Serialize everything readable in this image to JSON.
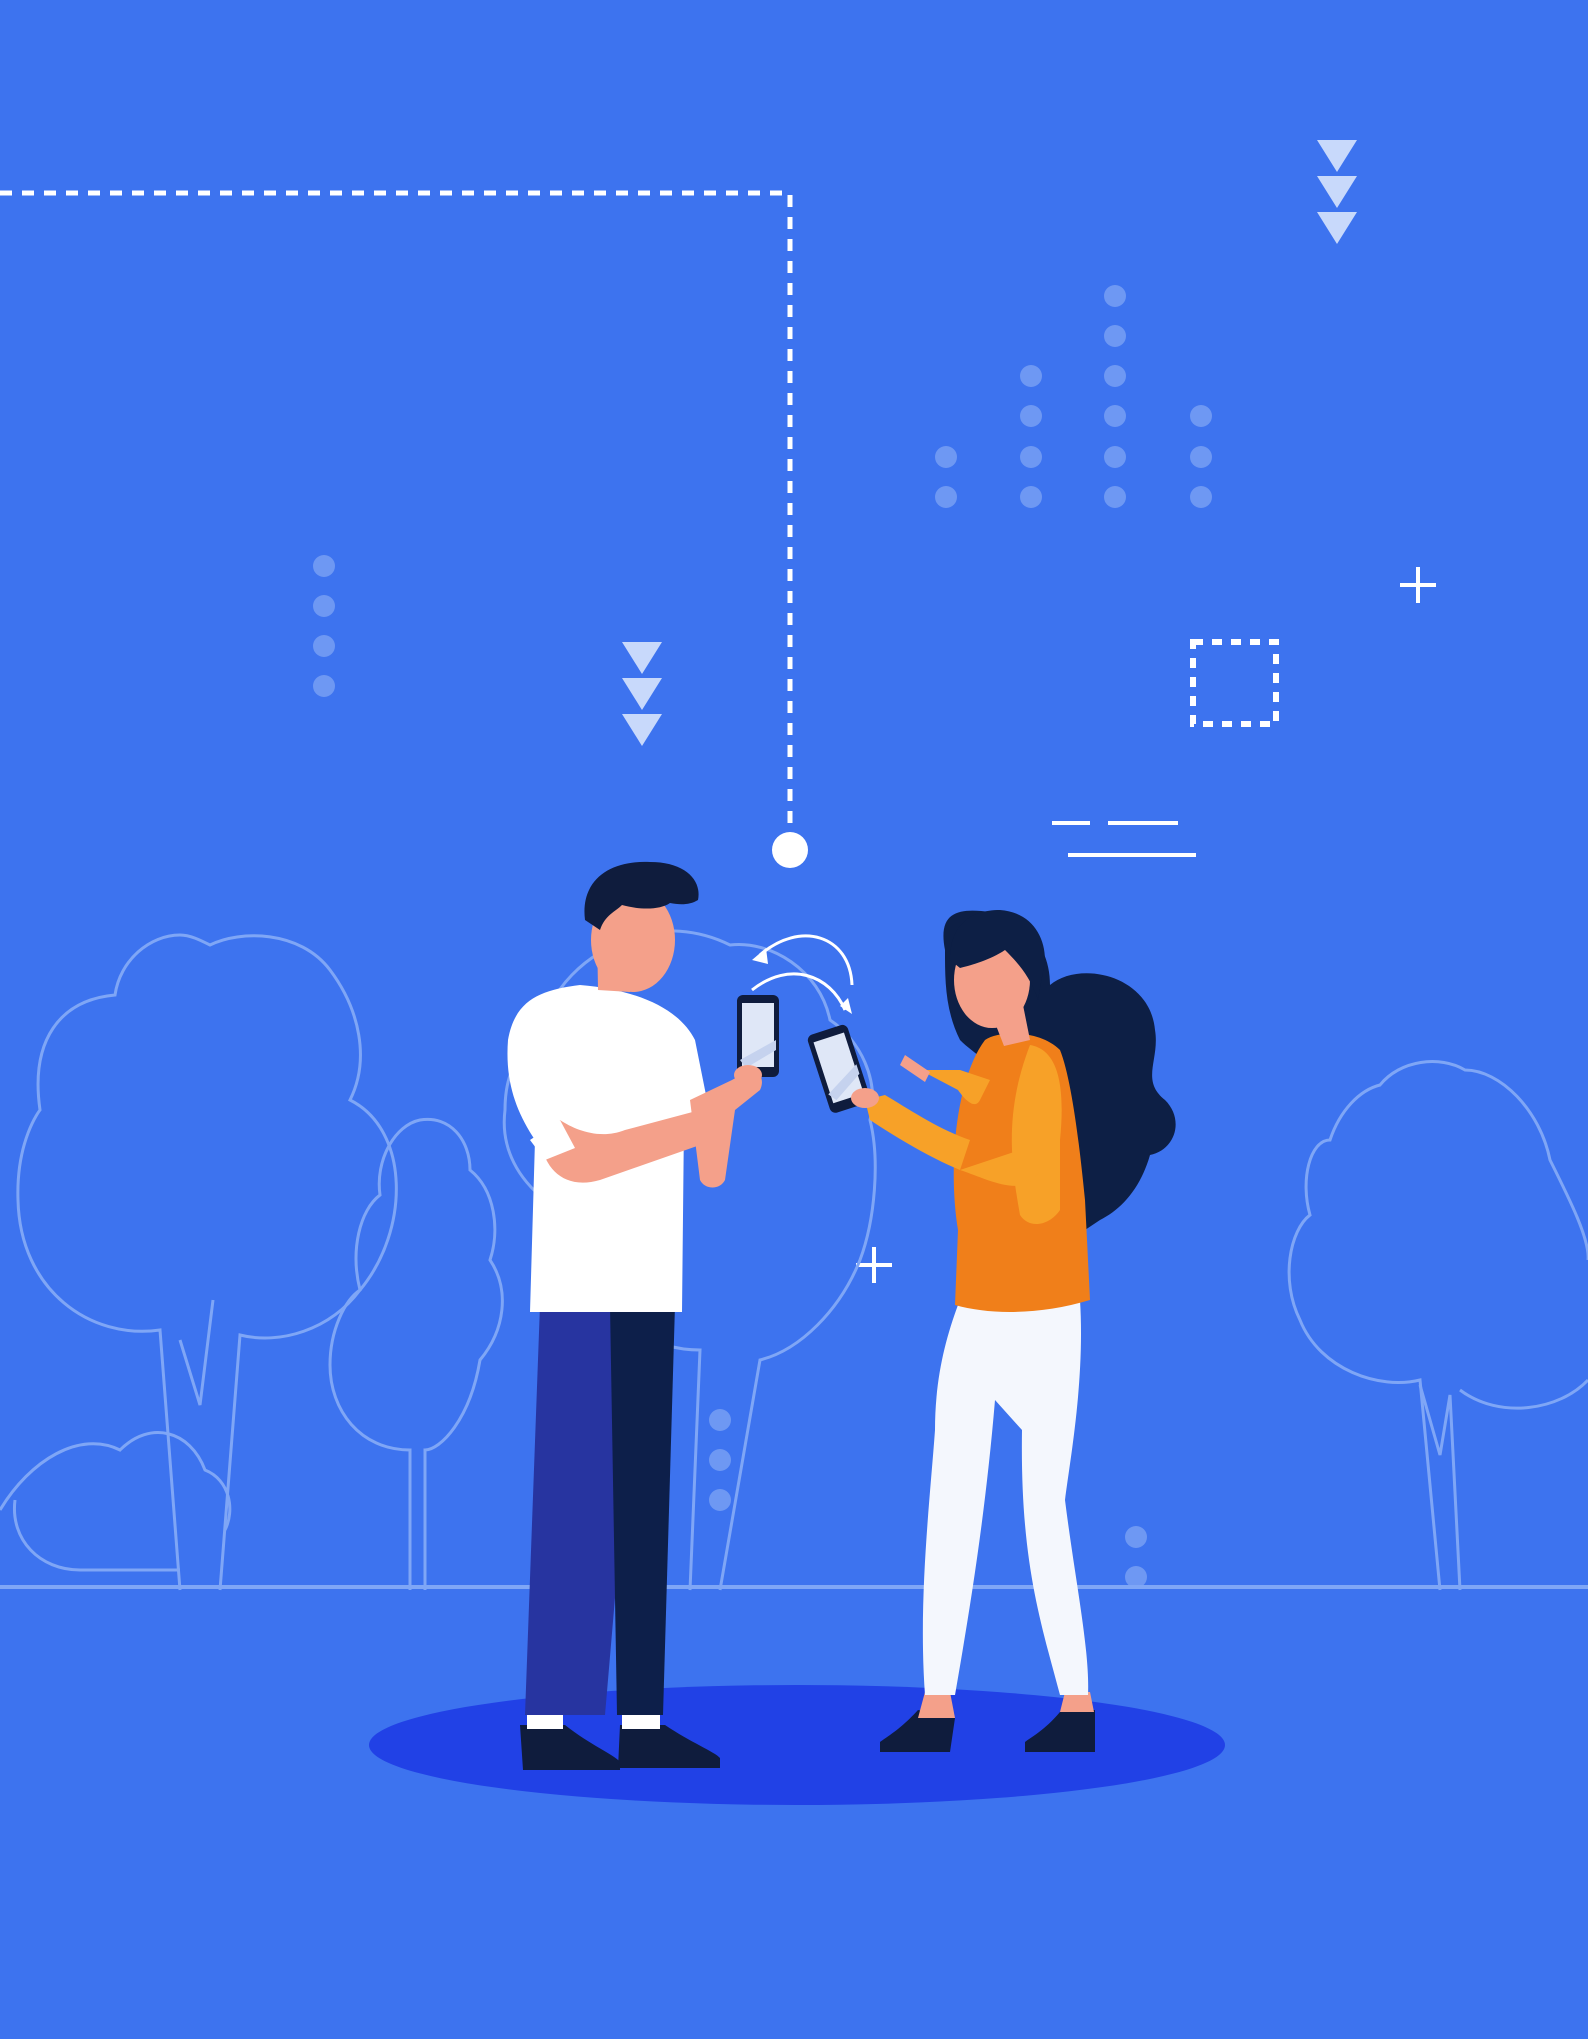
{
  "illustration": {
    "subject": "two-people-sharing-phones",
    "colors": {
      "background": "#3d73ef",
      "ground_shadow": "#2141e6",
      "outline": "#7fa6f6",
      "decor_light": "#c8d9fb",
      "decor_dots": "#6e98f3",
      "white": "#ffffff",
      "man_shirt": "#ffffff",
      "man_pants": "#2734a0",
      "man_pants_dark": "#0d1f4a",
      "man_hair": "#0f1c3d",
      "skin": "#f4a08a",
      "woman_top": "#f07f1a",
      "woman_top_light": "#f7a128",
      "woman_hair": "#0d1f45",
      "woman_pants": "#f4f7fd",
      "shoes": "#0f1c3d",
      "phone_screen": "#dfe7f7"
    },
    "icons": [
      "triangle-arrows-icon",
      "plus-icon",
      "dashed-square-icon",
      "exchange-arrows-icon"
    ]
  }
}
